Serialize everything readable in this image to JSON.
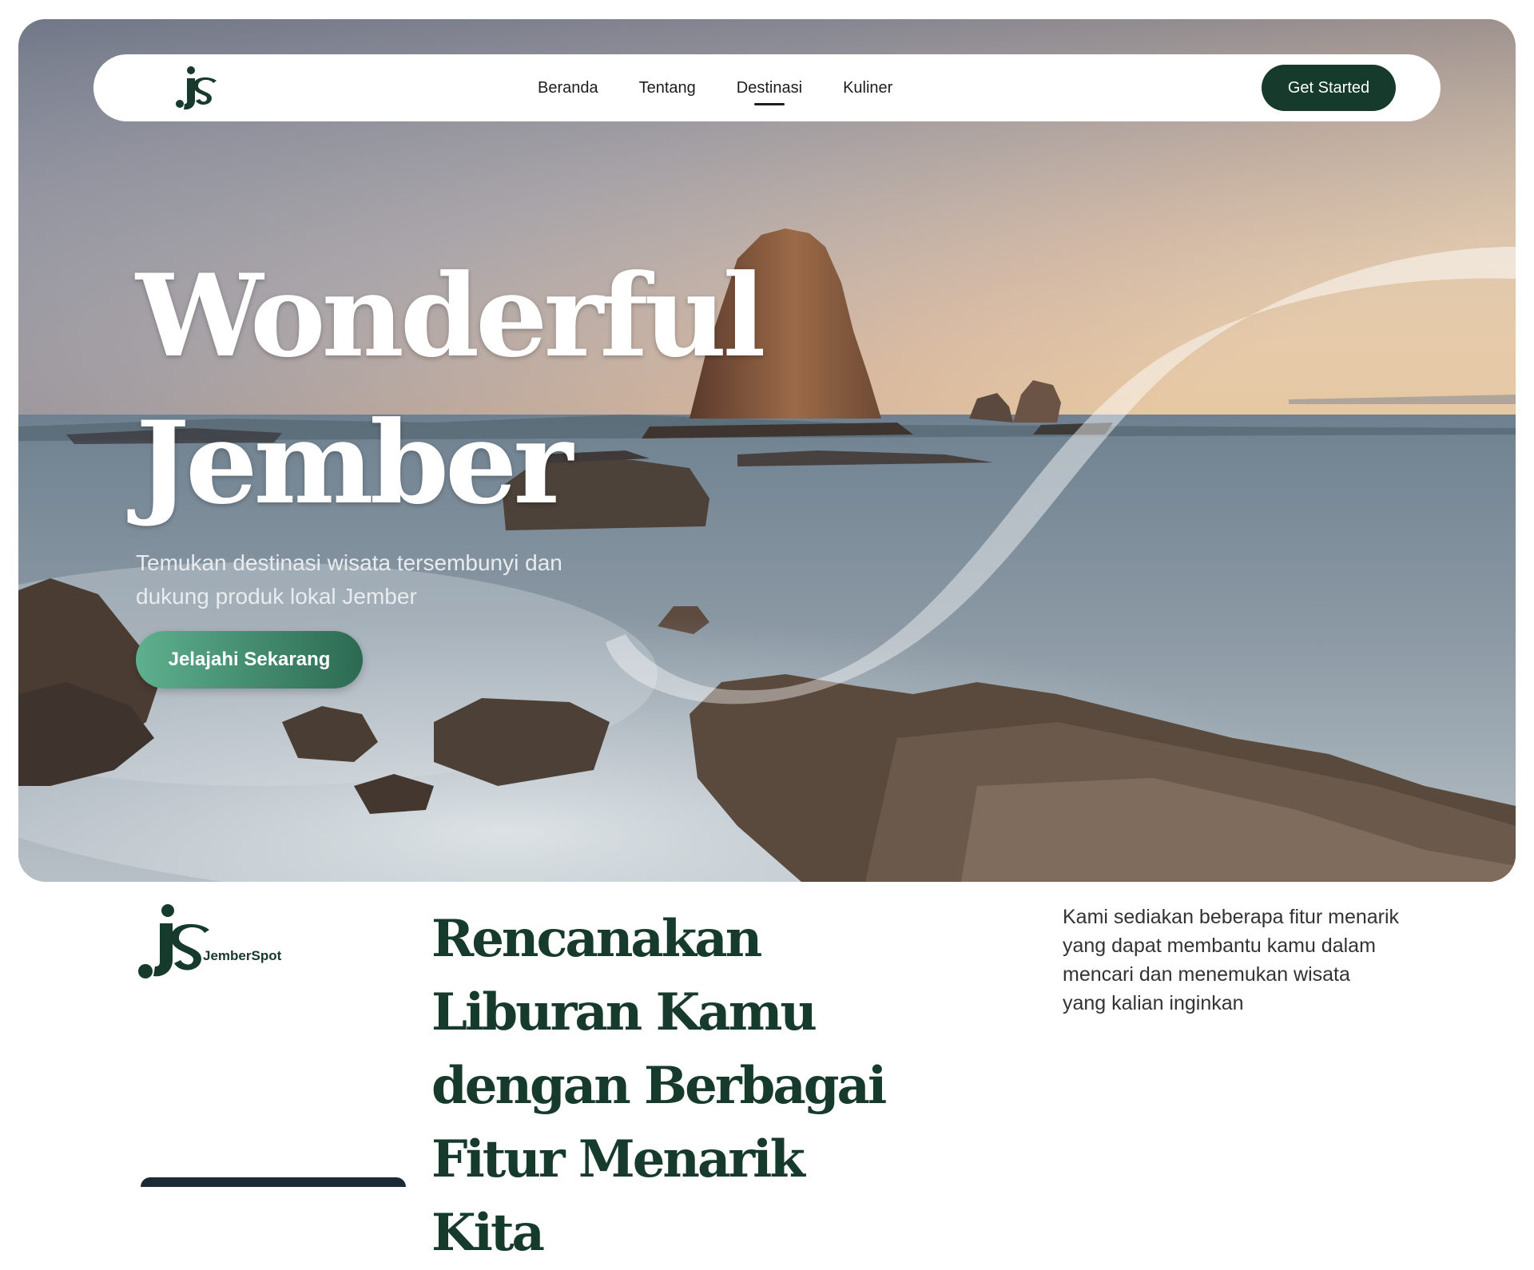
{
  "nav": {
    "logo_alt": "JS",
    "links": [
      {
        "label": "Beranda",
        "active": false
      },
      {
        "label": "Tentang",
        "active": false
      },
      {
        "label": "Destinasi",
        "active": true
      },
      {
        "label": "Kuliner",
        "active": false
      }
    ],
    "cta_label": "Get Started"
  },
  "hero": {
    "title_line1": "Wonderful",
    "title_line2": "Jember",
    "subtitle_line1": "Temukan destinasi wisata tersembunyi dan",
    "subtitle_line2": "dukung produk lokal Jember",
    "button_label": "Jelajahi Sekarang"
  },
  "features": {
    "brand_name": "JemberSpot",
    "heading_lines": [
      "Rencanakan",
      "Liburan Kamu",
      "dengan Berbagai",
      "Fitur Menarik Kita"
    ],
    "description_lines": [
      "Kami sediakan beberapa fitur menarik",
      "yang dapat membantu kamu dalam",
      "mencari dan menemukan wisata",
      "yang kalian inginkan"
    ]
  },
  "colors": {
    "brand_dark_green": "#163a2b",
    "button_gradient_start": "#5eb08f",
    "button_gradient_end": "#2c6a52",
    "nav_background": "#ffffff",
    "body_text": "#333333"
  },
  "icons": {
    "nav_logo": "js-logo-icon",
    "brand_logo": "jemberspot-logo-icon"
  }
}
